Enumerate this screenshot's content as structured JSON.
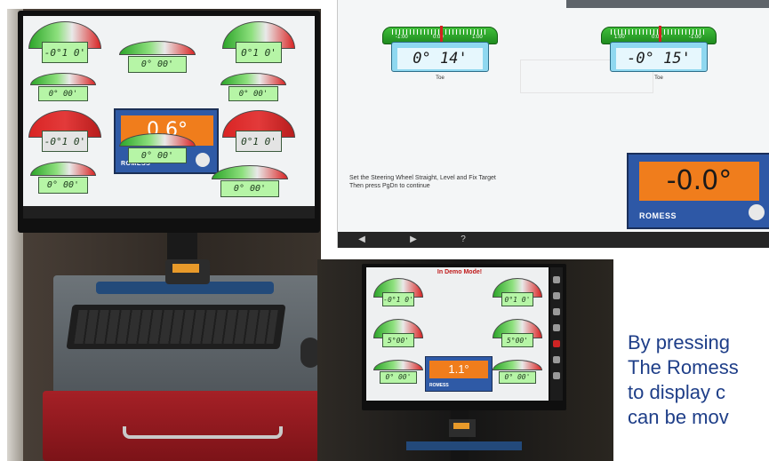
{
  "left_photo": {
    "gauges": [
      {
        "value": "-0°1 0'",
        "style": "green"
      },
      {
        "value": "0°1 0'",
        "style": "green"
      },
      {
        "value": "0° 00'",
        "style": "flat"
      },
      {
        "value": "0° 00'",
        "style": "flat"
      },
      {
        "value": "0° 00'",
        "style": "flat"
      },
      {
        "value": "-0°1 0'",
        "style": "red"
      },
      {
        "value": "0°1 0'",
        "style": "red"
      },
      {
        "value": "0° 00'",
        "style": "flat"
      },
      {
        "value": "0° 00'",
        "style": "flat"
      },
      {
        "value": "0° 00'",
        "style": "flat"
      }
    ],
    "level_display": {
      "value": "0.6°",
      "brand": "ROMESS"
    }
  },
  "alignment_screen": {
    "toe_left": {
      "value": "0° 14'",
      "caption": "Toe",
      "scale_labels": [
        "-1:00",
        "0:00",
        "1:00"
      ]
    },
    "toe_right": {
      "value": "-0° 15'",
      "caption": "Toe",
      "scale_labels": [
        "1:00",
        "0:00",
        "-1:00"
      ]
    },
    "instruction_line1": "Set the Steering Wheel Straight, Level and Fix Target",
    "instruction_line2": "Then press PgDn to continue",
    "level_display": {
      "value": "-0.0°",
      "brand": "ROMESS"
    },
    "nav": [
      "back-arrow",
      "forward-arrow",
      "help"
    ]
  },
  "bottom_photo": {
    "title": "In Demo Mode!",
    "gauges": [
      {
        "value": "-0°1 0'"
      },
      {
        "value": "0°1 0'"
      },
      {
        "value": "5°00'"
      },
      {
        "value": "5°00'"
      },
      {
        "value": "0° 00'"
      },
      {
        "value": "0° 00'"
      }
    ],
    "level_display": {
      "value": "1.1°",
      "brand": "ROMESS"
    }
  },
  "caption": {
    "line1": "By pressing",
    "line2": "The Romess",
    "line3": "to display c",
    "line4": "can be mov"
  },
  "colors": {
    "accent_orange": "#f07d1c",
    "panel_blue": "#2f5aa6",
    "caption_blue": "#1e3e88",
    "gauge_green": "#b6f5a6",
    "gauge_red": "#d92525"
  }
}
